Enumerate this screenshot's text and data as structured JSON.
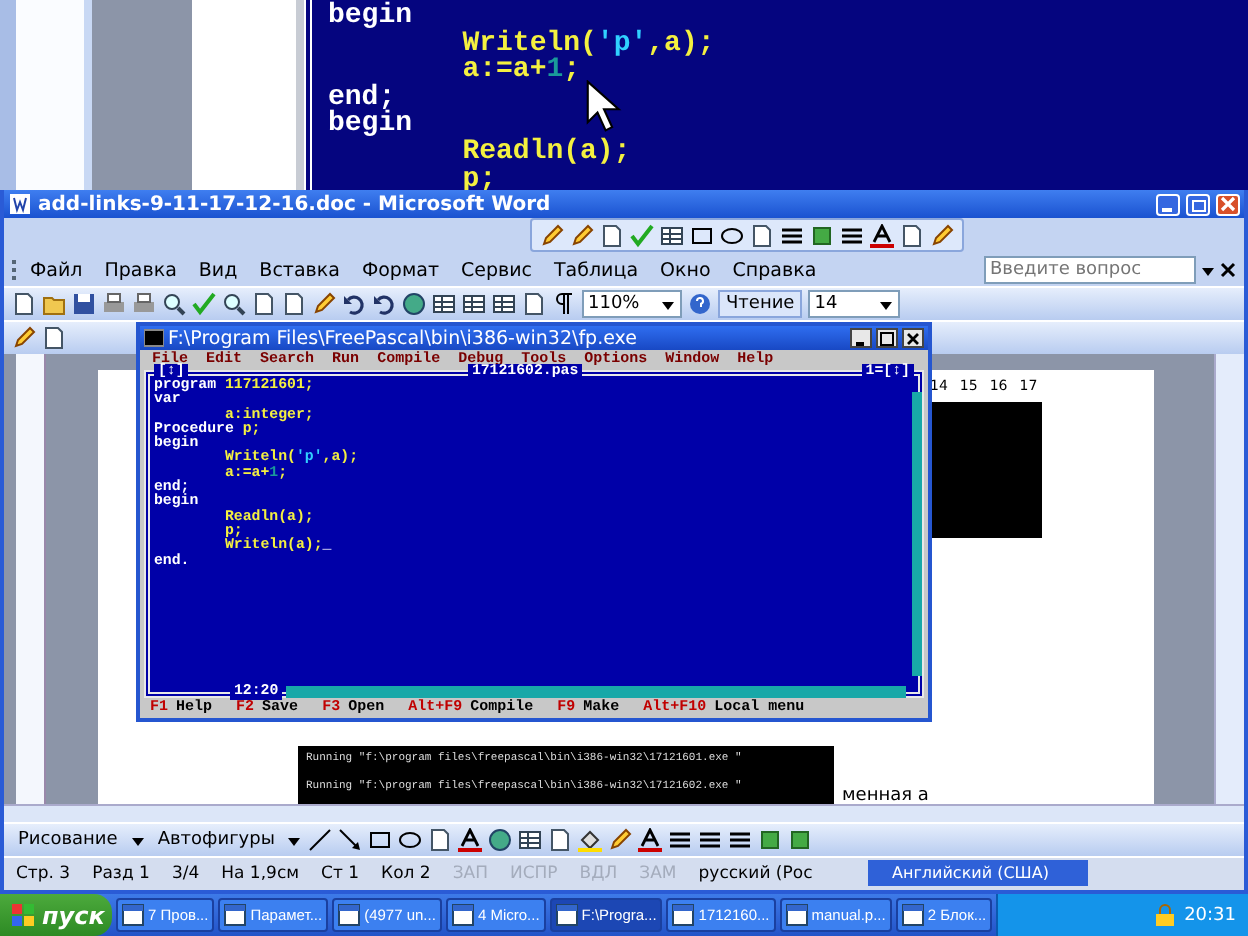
{
  "background_editor": {
    "lines": [
      [
        {
          "text": "begin",
          "kind": "kw"
        }
      ],
      [
        {
          "text": "        Writeln(",
          "kind": "id"
        },
        {
          "text": "'p'",
          "kind": "str"
        },
        {
          "text": ",a);",
          "kind": "id"
        }
      ],
      [
        {
          "text": "        a:=a+",
          "kind": "id"
        },
        {
          "text": "1",
          "kind": "num"
        },
        {
          "text": ";",
          "kind": "id"
        }
      ],
      [
        {
          "text": "end;",
          "kind": "kw"
        }
      ],
      [
        {
          "text": "begin",
          "kind": "kw"
        }
      ],
      [
        {
          "text": "        Readln(a);",
          "kind": "id"
        }
      ],
      [
        {
          "text": "        p;",
          "kind": "id"
        }
      ]
    ]
  },
  "word_window": {
    "title": "add-links-9-11-17-12-16.doc - Microsoft Word",
    "menu": [
      "Файл",
      "Правка",
      "Вид",
      "Вставка",
      "Формат",
      "Сервис",
      "Таблица",
      "Окно",
      "Справка"
    ],
    "help_field": {
      "placeholder": "Введите вопрос"
    },
    "zoom": "110%",
    "reading_button": "Чтение",
    "font_size": "14",
    "document": {
      "ruler_numbers": [
        "14",
        "15",
        "16",
        "17"
      ],
      "console_lines": [
        "Running \"f:\\program files\\freepascal\\bin\\i386-win32\\17121601.exe \"",
        "Running \"f:\\program files\\freepascal\\bin\\i386-win32\\17121602.exe \""
      ],
      "text": "менная а"
    },
    "drawing_menu": "Рисование",
    "autoshapes_menu": "Автофигуры",
    "status_bar": [
      {
        "text": "Стр. 3",
        "disabled": false
      },
      {
        "text": "Разд 1",
        "disabled": false
      },
      {
        "text": "3/4",
        "disabled": false
      },
      {
        "text": "На 1,9см",
        "disabled": false
      },
      {
        "text": "Ст 1",
        "disabled": false
      },
      {
        "text": "Кол 2",
        "disabled": false
      },
      {
        "text": "ЗАП",
        "disabled": true
      },
      {
        "text": "ИСПР",
        "disabled": true
      },
      {
        "text": "ВДЛ",
        "disabled": true
      },
      {
        "text": "ЗАМ",
        "disabled": true
      },
      {
        "text": "русский (Рос",
        "disabled": false
      }
    ]
  },
  "fp_window": {
    "title": "F:\\Program Files\\FreePascal\\bin\\i386-win32\\fp.exe",
    "menu": [
      "File",
      "Edit",
      "Search",
      "Run",
      "Compile",
      "Debug",
      "Tools",
      "Options",
      "Window",
      "Help"
    ],
    "close_box": "[↕]",
    "file_name": "17121602.pas",
    "window_number": "1=[↕]",
    "position": "12:20",
    "lines": [
      [
        {
          "text": "program ",
          "kind": "kw"
        },
        {
          "text": "117121601;",
          "kind": "id"
        }
      ],
      [
        {
          "text": "var",
          "kind": "kw"
        }
      ],
      [
        {
          "text": "        a:integer;",
          "kind": "id"
        }
      ],
      [
        {
          "text": "Procedure ",
          "kind": "kw"
        },
        {
          "text": "p;",
          "kind": "id"
        }
      ],
      [
        {
          "text": "begin",
          "kind": "kw"
        }
      ],
      [
        {
          "text": "        Writeln(",
          "kind": "id"
        },
        {
          "text": "'p'",
          "kind": "str"
        },
        {
          "text": ",a);",
          "kind": "id"
        }
      ],
      [
        {
          "text": "        a:=a+",
          "kind": "id"
        },
        {
          "text": "1",
          "kind": "num"
        },
        {
          "text": ";",
          "kind": "id"
        }
      ],
      [
        {
          "text": "end;",
          "kind": "kw"
        }
      ],
      [
        {
          "text": "begin",
          "kind": "kw"
        }
      ],
      [
        {
          "text": "        Readln(a);",
          "kind": "id"
        }
      ],
      [
        {
          "text": "        p;",
          "kind": "id"
        }
      ],
      [
        {
          "text": "        Writeln(a);",
          "kind": "id"
        },
        {
          "text": "_",
          "kind": "cursor"
        }
      ],
      [
        {
          "text": "end.",
          "kind": "kw"
        }
      ]
    ],
    "status_keys": [
      {
        "key": "F1",
        "label": "Help"
      },
      {
        "key": "F2",
        "label": "Save"
      },
      {
        "key": "F3",
        "label": "Open"
      },
      {
        "key": "Alt+F9",
        "label": "Compile"
      },
      {
        "key": "F9",
        "label": "Make"
      },
      {
        "key": "Alt+F10",
        "label": "Local menu"
      }
    ]
  },
  "language_bar": {
    "label": "Английский (США)"
  },
  "taskbar": {
    "start": "пуск",
    "items": [
      {
        "label": "7 Пров...",
        "selected": false
      },
      {
        "label": "Парамет...",
        "selected": false
      },
      {
        "label": "(4977 un...",
        "selected": false
      },
      {
        "label": "4 Micro...",
        "selected": false
      },
      {
        "label": "F:\\Progra...",
        "selected": true
      },
      {
        "label": "1712160...",
        "selected": false
      },
      {
        "label": "manual.p...",
        "selected": false
      },
      {
        "label": "2 Блок...",
        "selected": false
      }
    ],
    "clock": "20:31"
  }
}
